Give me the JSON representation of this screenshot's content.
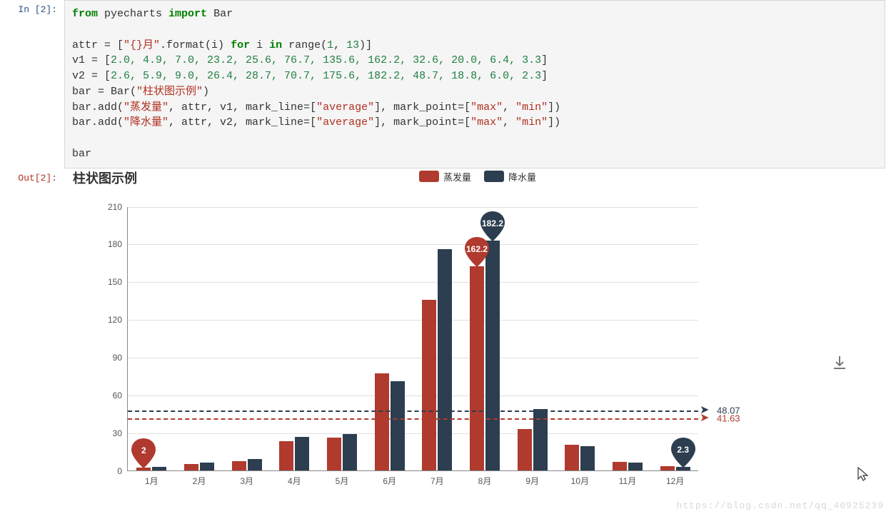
{
  "prompt_in": "In [2]:",
  "prompt_out": "Out[2]:",
  "code": {
    "line1_from": "from",
    "line1_mod": " pyecharts ",
    "line1_import": "import",
    "line1_rest": " Bar",
    "line3_a": "attr = [",
    "line3_str": "\"{}月\"",
    "line3_b": ".format(i) ",
    "line3_for": "for",
    "line3_c": " i ",
    "line3_in": "in",
    "line3_d": " range(",
    "line3_n1": "1",
    "line3_e": ", ",
    "line3_n2": "13",
    "line3_f": ")]",
    "v1_label": "v1 = [",
    "v1_vals": "2.0, 4.9, 7.0, 23.2, 25.6, 76.7, 135.6, 162.2, 32.6, 20.0, 6.4, 3.3",
    "v1_end": "]",
    "v2_label": "v2 = [",
    "v2_vals": "2.6, 5.9, 9.0, 26.4, 28.7, 70.7, 175.6, 182.2, 48.7, 18.8, 6.0, 2.3",
    "v2_end": "]",
    "bar_ctor_a": "bar = Bar(",
    "bar_ctor_str": "\"柱状图示例\"",
    "bar_ctor_b": ")",
    "add1_a": "bar.add(",
    "add1_s1": "\"蒸发量\"",
    "add1_b": ", attr, v1, mark_line=[",
    "add1_s2": "\"average\"",
    "add1_c": "], mark_point=[",
    "add1_s3": "\"max\"",
    "add1_d": ", ",
    "add1_s4": "\"min\"",
    "add1_e": "])",
    "add2_a": "bar.add(",
    "add2_s1": "\"降水量\"",
    "add2_b": ", attr, v2, mark_line=[",
    "add2_s2": "\"average\"",
    "add2_c": "], mark_point=[",
    "add2_s3": "\"max\"",
    "add2_d": ", ",
    "add2_s4": "\"min\"",
    "add2_e": "])",
    "last": "bar"
  },
  "chart_title": "柱状图示例",
  "legend": {
    "s1": "蒸发量",
    "s2": "降水量"
  },
  "watermark": "https://blog.csdn.net/qq_40925239",
  "chart_data": {
    "type": "bar",
    "title": "柱状图示例",
    "xlabel": "",
    "ylabel": "",
    "ylim": [
      0,
      210
    ],
    "yticks": [
      0,
      30,
      60,
      90,
      120,
      150,
      180,
      210
    ],
    "categories": [
      "1月",
      "2月",
      "3月",
      "4月",
      "5月",
      "6月",
      "7月",
      "8月",
      "9月",
      "10月",
      "11月",
      "12月"
    ],
    "series": [
      {
        "name": "蒸发量",
        "color": "#b03a2e",
        "values": [
          2.0,
          4.9,
          7.0,
          23.2,
          25.6,
          76.7,
          135.6,
          162.2,
          32.6,
          20.0,
          6.4,
          3.3
        ],
        "average": 41.63,
        "mark_point_max": {
          "value": 162.2,
          "category": "8月"
        },
        "mark_point_min": {
          "value": 2.0,
          "category": "1月",
          "label": "2"
        }
      },
      {
        "name": "降水量",
        "color": "#2c3e50",
        "values": [
          2.6,
          5.9,
          9.0,
          26.4,
          28.7,
          70.7,
          175.6,
          182.2,
          48.7,
          18.8,
          6.0,
          2.3
        ],
        "average": 48.07,
        "mark_point_max": {
          "value": 182.2,
          "category": "8月"
        },
        "mark_point_min": {
          "value": 2.3,
          "category": "12月"
        }
      }
    ]
  },
  "pins": {
    "red_max": "162.2",
    "blue_max": "182.2",
    "red_min": "2",
    "blue_min": "2.3"
  },
  "avg": {
    "red": "41.63",
    "blue": "48.07"
  }
}
